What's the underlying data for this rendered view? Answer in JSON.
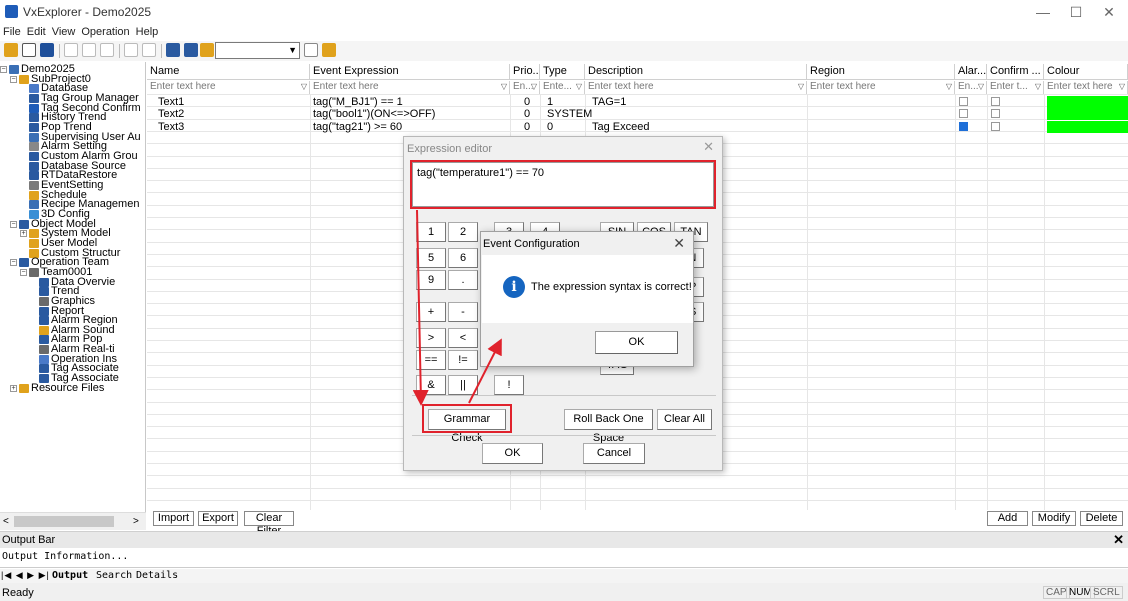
{
  "window": {
    "title": "VxExplorer - Demo2025",
    "minimize": "—",
    "maximize": "☐",
    "close": "✕"
  },
  "menu": [
    "File",
    "Edit",
    "View",
    "Operation",
    "Help"
  ],
  "tree": {
    "items": [
      {
        "label": "Demo2025",
        "icon": "project-icon",
        "color": "#3a6fb5"
      },
      {
        "label": "SubProject0",
        "icon": "folder-icon",
        "color": "#e0a21c"
      },
      {
        "label": "Database",
        "icon": "database-icon",
        "color": "#4a7ac8"
      },
      {
        "label": "Tag Group Manager",
        "icon": "tag-group-icon",
        "color": "#2a5aa0"
      },
      {
        "label": "Tag Second Confirm",
        "icon": "check-icon",
        "color": "#1e5cb8"
      },
      {
        "label": "History Trend",
        "icon": "trend-icon",
        "color": "#2a5aa0"
      },
      {
        "label": "Pop Trend",
        "icon": "pop-trend-icon",
        "color": "#2a5aa0"
      },
      {
        "label": "Supervising User Au",
        "icon": "user-icon",
        "color": "#3a6fb5"
      },
      {
        "label": "Alarm Setting",
        "icon": "alarm-icon",
        "color": "#888888"
      },
      {
        "label": "Custom Alarm Grou",
        "icon": "alarm-group-icon",
        "color": "#2a5aa0"
      },
      {
        "label": "Database Source",
        "icon": "database-source-icon",
        "color": "#2a5aa0"
      },
      {
        "label": "RTDataRestore",
        "icon": "restore-icon",
        "color": "#2a5aa0"
      },
      {
        "label": "EventSetting",
        "icon": "event-icon",
        "color": "#7a7a7a"
      },
      {
        "label": "Schedule",
        "icon": "schedule-icon",
        "color": "#e0a21c"
      },
      {
        "label": "Recipe Managemen",
        "icon": "recipe-icon",
        "color": "#3a6fb5"
      },
      {
        "label": "3D Config",
        "icon": "3d-icon",
        "color": "#3a8fd5"
      },
      {
        "label": "Object Model",
        "icon": "object-model-icon",
        "color": "#2a5aa0"
      },
      {
        "label": "System Model",
        "icon": "folder-icon",
        "color": "#e0a21c"
      },
      {
        "label": "User Model",
        "icon": "folder-icon",
        "color": "#e0a21c"
      },
      {
        "label": "Custom Structur",
        "icon": "folder-icon",
        "color": "#e0a21c"
      },
      {
        "label": "Operation Team",
        "icon": "team-icon",
        "color": "#2a5aa0"
      },
      {
        "label": "Team0001",
        "icon": "team-member-icon",
        "color": "#6a6a6a"
      },
      {
        "label": "Data Overvie",
        "icon": "data-overview-icon",
        "color": "#2a5aa0"
      },
      {
        "label": "Trend",
        "icon": "trend-icon",
        "color": "#2a5aa0"
      },
      {
        "label": "Graphics",
        "icon": "graphics-icon",
        "color": "#6a6a6a"
      },
      {
        "label": "Report",
        "icon": "report-icon",
        "color": "#2a5aa0"
      },
      {
        "label": "Alarm Region",
        "icon": "alarm-region-icon",
        "color": "#2a5aa0"
      },
      {
        "label": "Alarm Sound",
        "icon": "alarm-sound-icon",
        "color": "#e0a21c"
      },
      {
        "label": "Alarm Pop",
        "icon": "alarm-pop-icon",
        "color": "#2a5aa0"
      },
      {
        "label": "Alarm Real-ti",
        "icon": "alarm-realtime-icon",
        "color": "#6a6a6a"
      },
      {
        "label": "Operation Ins",
        "icon": "operation-icon",
        "color": "#4a7ac8"
      },
      {
        "label": "Tag Associate",
        "icon": "tag-associate-icon",
        "color": "#2a5aa0"
      },
      {
        "label": "Tag Associate",
        "icon": "tag-associate-icon",
        "color": "#2a5aa0"
      },
      {
        "label": "Resource Files",
        "icon": "resource-icon",
        "color": "#e0a21c"
      }
    ]
  },
  "grid": {
    "columns": [
      "Name",
      "Event Expression",
      "Prio...",
      "Type",
      "Description",
      "Region",
      "Alar...",
      "Confirm ...",
      "Colour"
    ],
    "filters": [
      "Enter text here",
      "Enter text here",
      "En...",
      "Ente...",
      "Enter text here",
      "Enter text here",
      "En...",
      "Enter t...",
      "Enter text here"
    ],
    "filter_icon": "▽",
    "rows": [
      {
        "name": "Text1",
        "expr": "tag(\"M_BJ1\") == 1",
        "prio": "0",
        "type": "1",
        "desc": "TAG=1",
        "region": "",
        "alarm": false,
        "confirm": false,
        "colour": "#00ff00"
      },
      {
        "name": "Text2",
        "expr": "tag(\"bool1\")(ON<=>OFF)",
        "prio": "0",
        "type": "SYSTEM",
        "desc": "",
        "region": "",
        "alarm": false,
        "confirm": false,
        "colour": "#00ff00"
      },
      {
        "name": "Text3",
        "expr": "tag(\"tag21\") >= 60",
        "prio": "0",
        "type": "0",
        "desc": "Tag Exceed",
        "region": "",
        "alarm": true,
        "confirm": false,
        "colour": "#00ff00"
      }
    ]
  },
  "grid_buttons": {
    "import": "Import",
    "export": "Export",
    "clear_filter": "Clear Filter",
    "add": "Add",
    "modify": "Modify",
    "delete": "Delete"
  },
  "output": {
    "title": "Output Bar",
    "close": "✕",
    "text": "Output Information...",
    "nav": "|◀ ◀ ▶ ▶|",
    "tabs": [
      "Output",
      "Search",
      "Details"
    ]
  },
  "status": {
    "ready": "Ready",
    "indicators": [
      "CAP",
      "NUM",
      "SCRL"
    ]
  },
  "expr_editor": {
    "title": "Expression editor",
    "close": "✕",
    "expression": "tag(\"temperature1\") == 70",
    "keys": [
      "1",
      "2",
      "3",
      "4",
      "SIN",
      "COS",
      "TAN",
      "5",
      "6",
      "TN",
      "9",
      ".",
      "XP",
      "+",
      "-",
      "BS",
      ">",
      "<",
      "==",
      "!=",
      "TAG",
      "&",
      "||",
      "!"
    ],
    "grammar_check": "Grammar Check",
    "roll_back": "Roll Back One Space",
    "clear_all": "Clear All",
    "ok": "OK",
    "cancel": "Cancel"
  },
  "event_config": {
    "title": "Event Configuration",
    "close": "✕",
    "message": "The expression syntax is correct!",
    "ok": "OK",
    "icon": "info-icon"
  },
  "annotation_color": "#e0222c"
}
